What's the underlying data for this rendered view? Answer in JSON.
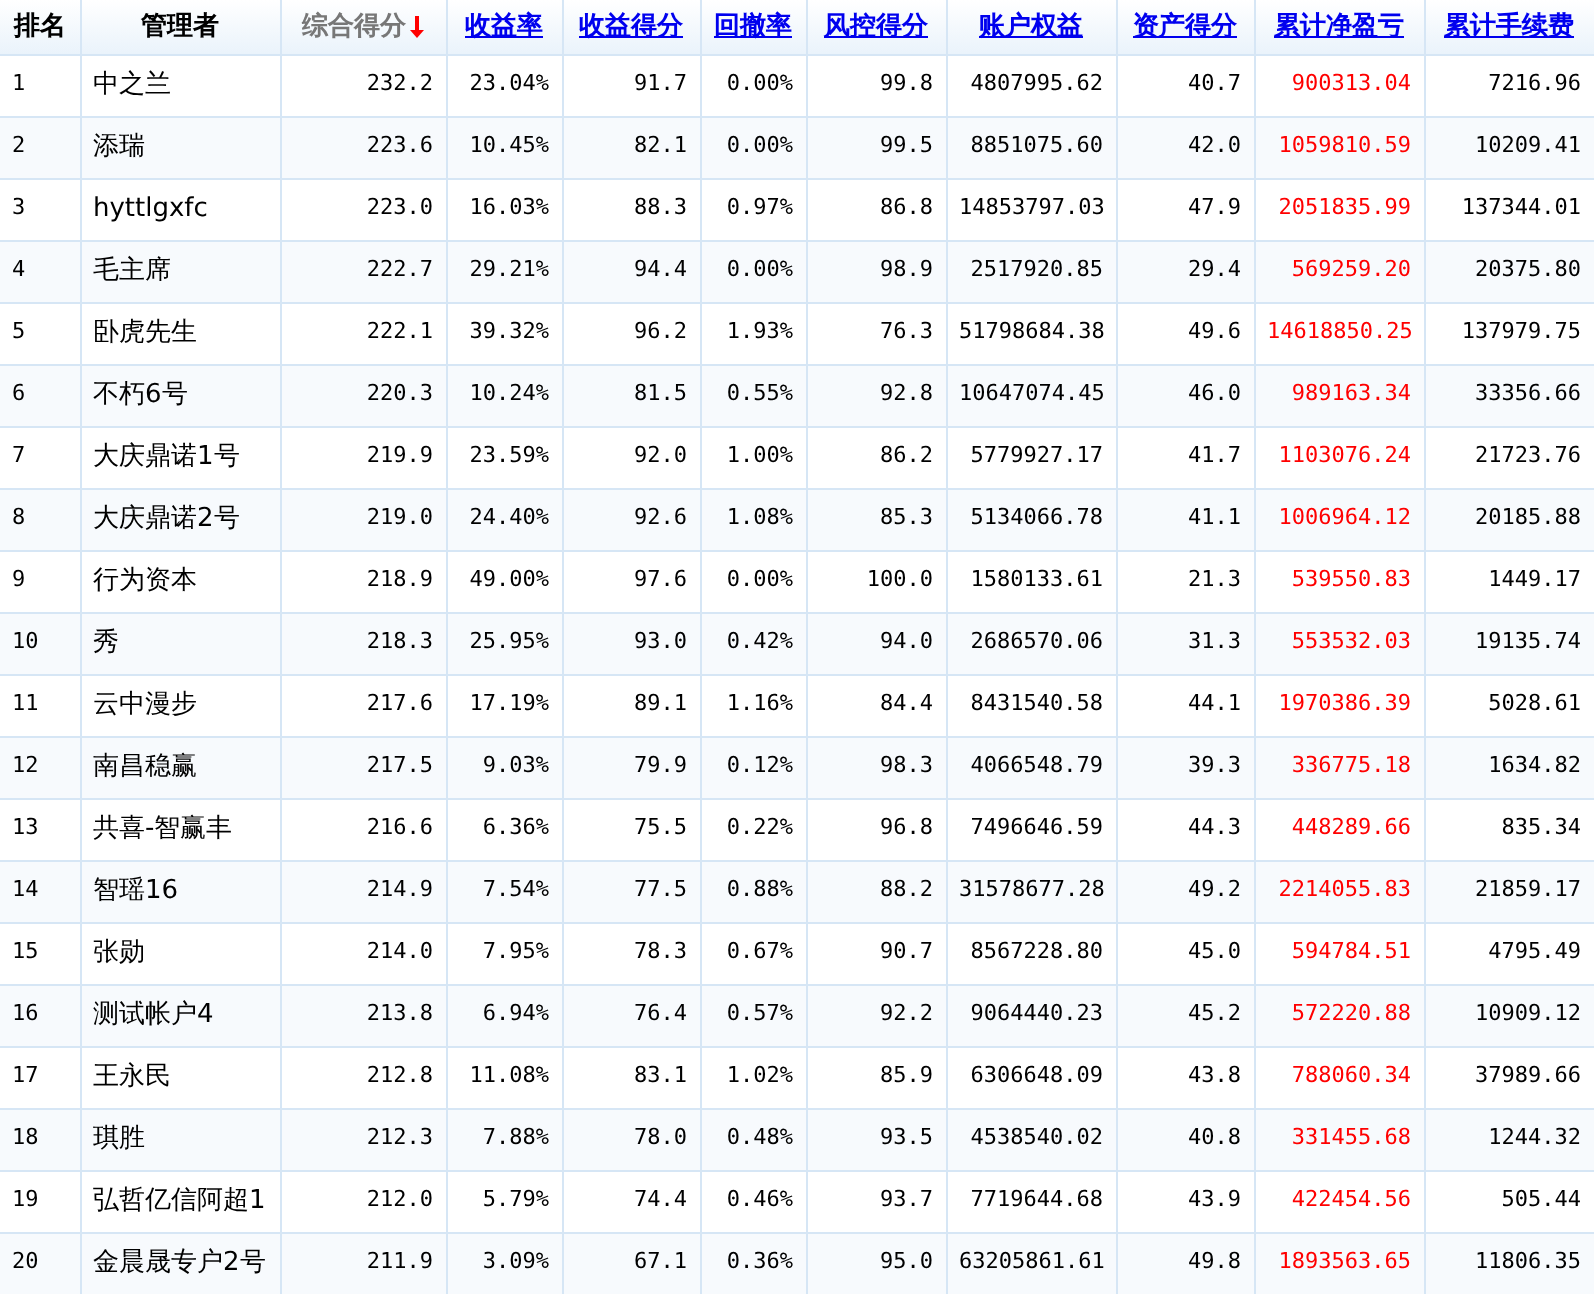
{
  "columns": [
    {
      "label": "排名",
      "kind": "plain",
      "color": "#000000"
    },
    {
      "label": "管理者",
      "kind": "plain",
      "color": "#000000"
    },
    {
      "label": "综合得分",
      "kind": "sorted",
      "color": "#000000"
    },
    {
      "label": "收益率",
      "kind": "link",
      "color": "#000000"
    },
    {
      "label": "收益得分",
      "kind": "link",
      "color": "#000000"
    },
    {
      "label": "回撤率",
      "kind": "link",
      "color": "#000000"
    },
    {
      "label": "风控得分",
      "kind": "link",
      "color": "#000000"
    },
    {
      "label": "账户权益",
      "kind": "link",
      "color": "#000000"
    },
    {
      "label": "资产得分",
      "kind": "link",
      "color": "#000000"
    },
    {
      "label": "累计净盈亏",
      "kind": "link",
      "color": "#ff0000"
    },
    {
      "label": "累计手续费",
      "kind": "link",
      "color": "#000000"
    }
  ],
  "rows": [
    [
      "1",
      "中之兰",
      "232.2",
      "23.04%",
      "91.7",
      "0.00%",
      "99.8",
      "4807995.62",
      "40.7",
      "900313.04",
      "7216.96"
    ],
    [
      "2",
      "添瑞",
      "223.6",
      "10.45%",
      "82.1",
      "0.00%",
      "99.5",
      "8851075.60",
      "42.0",
      "1059810.59",
      "10209.41"
    ],
    [
      "3",
      "hyttlgxfc",
      "223.0",
      "16.03%",
      "88.3",
      "0.97%",
      "86.8",
      "14853797.03",
      "47.9",
      "2051835.99",
      "137344.01"
    ],
    [
      "4",
      "毛主席",
      "222.7",
      "29.21%",
      "94.4",
      "0.00%",
      "98.9",
      "2517920.85",
      "29.4",
      "569259.20",
      "20375.80"
    ],
    [
      "5",
      "卧虎先生",
      "222.1",
      "39.32%",
      "96.2",
      "1.93%",
      "76.3",
      "51798684.38",
      "49.6",
      "14618850.25",
      "137979.75"
    ],
    [
      "6",
      "不朽6号",
      "220.3",
      "10.24%",
      "81.5",
      "0.55%",
      "92.8",
      "10647074.45",
      "46.0",
      "989163.34",
      "33356.66"
    ],
    [
      "7",
      "大庆鼎诺1号",
      "219.9",
      "23.59%",
      "92.0",
      "1.00%",
      "86.2",
      "5779927.17",
      "41.7",
      "1103076.24",
      "21723.76"
    ],
    [
      "8",
      "大庆鼎诺2号",
      "219.0",
      "24.40%",
      "92.6",
      "1.08%",
      "85.3",
      "5134066.78",
      "41.1",
      "1006964.12",
      "20185.88"
    ],
    [
      "9",
      "行为资本",
      "218.9",
      "49.00%",
      "97.6",
      "0.00%",
      "100.0",
      "1580133.61",
      "21.3",
      "539550.83",
      "1449.17"
    ],
    [
      "10",
      "秀",
      "218.3",
      "25.95%",
      "93.0",
      "0.42%",
      "94.0",
      "2686570.06",
      "31.3",
      "553532.03",
      "19135.74"
    ],
    [
      "11",
      "云中漫步",
      "217.6",
      "17.19%",
      "89.1",
      "1.16%",
      "84.4",
      "8431540.58",
      "44.1",
      "1970386.39",
      "5028.61"
    ],
    [
      "12",
      "南昌稳赢",
      "217.5",
      "9.03%",
      "79.9",
      "0.12%",
      "98.3",
      "4066548.79",
      "39.3",
      "336775.18",
      "1634.82"
    ],
    [
      "13",
      "共喜-智赢丰",
      "216.6",
      "6.36%",
      "75.5",
      "0.22%",
      "96.8",
      "7496646.59",
      "44.3",
      "448289.66",
      "835.34"
    ],
    [
      "14",
      "智瑶16",
      "214.9",
      "7.54%",
      "77.5",
      "0.88%",
      "88.2",
      "31578677.28",
      "49.2",
      "2214055.83",
      "21859.17"
    ],
    [
      "15",
      "张勋",
      "214.0",
      "7.95%",
      "78.3",
      "0.67%",
      "90.7",
      "8567228.80",
      "45.0",
      "594784.51",
      "4795.49"
    ],
    [
      "16",
      "测试帐户4",
      "213.8",
      "6.94%",
      "76.4",
      "0.57%",
      "92.2",
      "9064440.23",
      "45.2",
      "572220.88",
      "10909.12"
    ],
    [
      "17",
      "王永民",
      "212.8",
      "11.08%",
      "83.1",
      "1.02%",
      "85.9",
      "6306648.09",
      "43.8",
      "788060.34",
      "37989.66"
    ],
    [
      "18",
      "琪胜",
      "212.3",
      "7.88%",
      "78.0",
      "0.48%",
      "93.5",
      "4538540.02",
      "40.8",
      "331455.68",
      "1244.32"
    ],
    [
      "19",
      "弘哲亿信阿超1",
      "212.0",
      "5.79%",
      "74.4",
      "0.46%",
      "93.7",
      "7719644.68",
      "43.9",
      "422454.56",
      "505.44"
    ],
    [
      "20",
      "金晨晟专户2号",
      "211.9",
      "3.09%",
      "67.1",
      "0.36%",
      "95.0",
      "63205861.61",
      "49.8",
      "1893563.65",
      "11806.35"
    ]
  ]
}
